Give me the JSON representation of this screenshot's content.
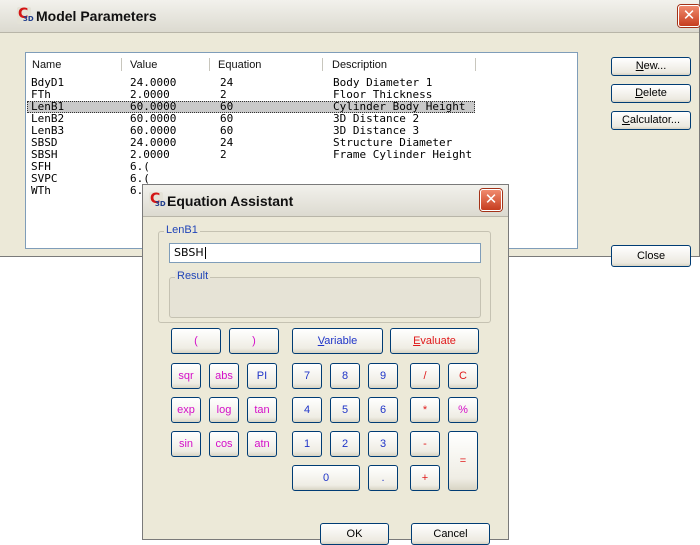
{
  "main": {
    "title": "Model Parameters",
    "close_glyph": "✕",
    "columns": [
      "Name",
      "Value",
      "Equation",
      "Description"
    ],
    "rows": [
      {
        "name": "BdyD1",
        "value": "24.0000",
        "equation": "24",
        "description": "Body Diameter 1"
      },
      {
        "name": "FTh",
        "value": "2.0000",
        "equation": "2",
        "description": "Floor Thickness"
      },
      {
        "name": "LenB1",
        "value": "60.0000",
        "equation": "60",
        "description": "Cylinder Body Height",
        "selected": true
      },
      {
        "name": "LenB2",
        "value": "60.0000",
        "equation": "60",
        "description": "3D Distance 2"
      },
      {
        "name": "LenB3",
        "value": "60.0000",
        "equation": "60",
        "description": "3D Distance 3"
      },
      {
        "name": "SBSD",
        "value": "24.0000",
        "equation": "24",
        "description": "Structure Diameter"
      },
      {
        "name": "SBSH",
        "value": "2.0000",
        "equation": "2",
        "description": "Frame Cylinder Height"
      },
      {
        "name": "SFH",
        "value": "6.(",
        "equation": "",
        "description": ""
      },
      {
        "name": "SVPC",
        "value": "6.(",
        "equation": "",
        "description": ""
      },
      {
        "name": "WTh",
        "value": "6.(",
        "equation": "",
        "description": ""
      }
    ],
    "buttons": {
      "new": {
        "mnemonic": "N",
        "rest": "ew..."
      },
      "delete": {
        "mnemonic": "D",
        "rest": "elete"
      },
      "calculator": {
        "mnemonic": "C",
        "rest": "alculator..."
      },
      "close": "Close"
    }
  },
  "dialog": {
    "title": "Equation Assistant",
    "close_glyph": "✕",
    "group_label": "LenB1",
    "input_value": "SBSH",
    "result_label": "Result",
    "keys": {
      "open_paren": "(",
      "close_paren": ")",
      "variable": {
        "mnemonic": "V",
        "rest": "ariable"
      },
      "evaluate": {
        "mnemonic": "E",
        "rest": "valuate"
      },
      "sqr": "sqr",
      "abs": "abs",
      "pi": "PI",
      "exp": "exp",
      "log": "log",
      "tan": "tan",
      "sin": "sin",
      "cos": "cos",
      "atn": "atn",
      "d7": "7",
      "d8": "8",
      "d9": "9",
      "d4": "4",
      "d5": "5",
      "d6": "6",
      "d1": "1",
      "d2": "2",
      "d3": "3",
      "d0": "0",
      "dot": ".",
      "divide": "/",
      "clear": "C",
      "multiply": "*",
      "percent": "%",
      "minus": "-",
      "plus": "+",
      "equals": "="
    },
    "ok": "OK",
    "cancel": "Cancel"
  },
  "colors": {
    "function_key": "#d40ec8",
    "digit_key": "#1f34c8",
    "operator_key": "#e0191a",
    "group_label": "#2145b8",
    "close_button": "#c63d1f"
  }
}
